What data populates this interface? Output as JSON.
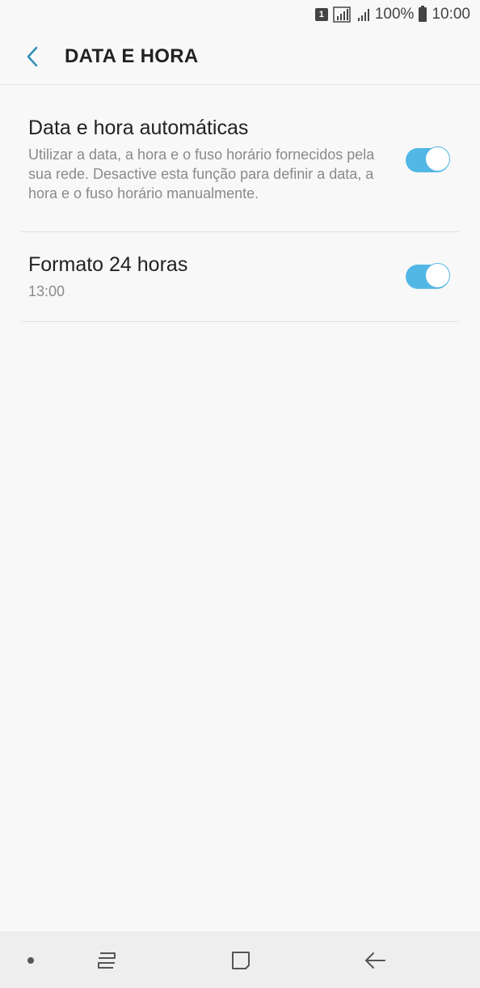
{
  "status_bar": {
    "sim_label": "1",
    "battery": "100%",
    "time": "10:00"
  },
  "header": {
    "title": "DATA E HORA"
  },
  "settings": {
    "items": [
      {
        "title": "Data e hora automáticas",
        "description": "Utilizar a data, a hora e o fuso horário fornecidos pela sua rede. Desactive esta função para definir a data, a hora e o fuso horário manualmente.",
        "enabled": true
      },
      {
        "title": "Formato 24 horas",
        "description": "13:00",
        "enabled": true
      }
    ]
  },
  "colors": {
    "accent": "#53b7e6",
    "background": "#f8f8f8"
  },
  "icons": [
    "back-arrow-icon",
    "signal-icon",
    "battery-icon",
    "recent-apps-icon",
    "home-icon",
    "back-icon"
  ]
}
